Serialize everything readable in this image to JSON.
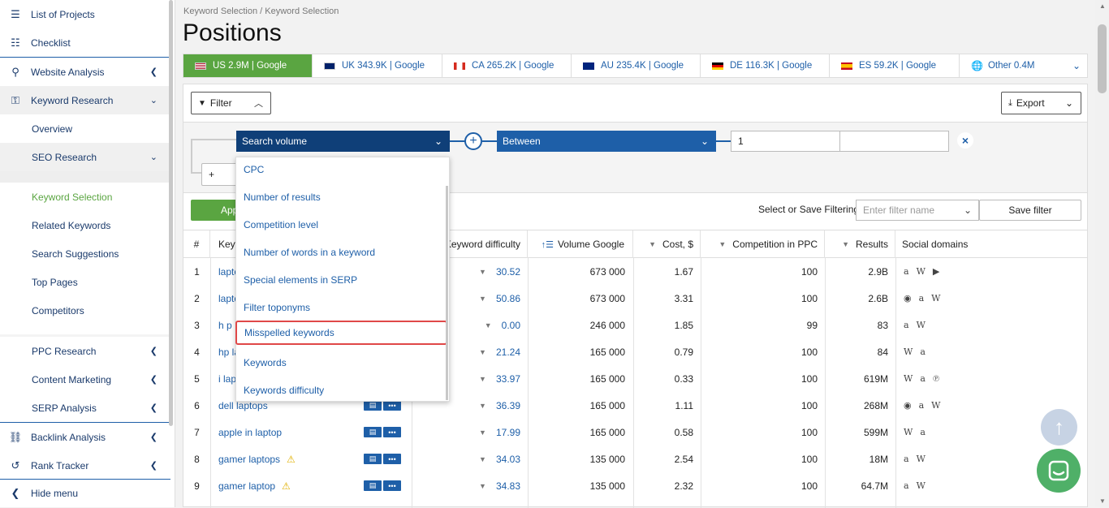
{
  "sidebar": {
    "items": [
      {
        "label": "List of Projects",
        "icon": "list-icon"
      },
      {
        "label": "Checklist",
        "icon": "checklist-icon"
      },
      {
        "label": "Website Analysis",
        "icon": "analysis-icon"
      },
      {
        "label": "Keyword Research",
        "icon": "key-icon"
      },
      {
        "label": "Overview"
      },
      {
        "label": "SEO Research"
      },
      {
        "label": "Keyword Selection"
      },
      {
        "label": "Related Keywords"
      },
      {
        "label": "Search Suggestions"
      },
      {
        "label": "Top Pages"
      },
      {
        "label": "Competitors"
      },
      {
        "label": "PPC Research"
      },
      {
        "label": "Content Marketing"
      },
      {
        "label": "SERP Analysis"
      },
      {
        "label": "Backlink Analysis",
        "icon": "link-icon"
      },
      {
        "label": "Rank Tracker",
        "icon": "history-icon"
      },
      {
        "label": "Hide menu",
        "icon": "chevron-left-icon"
      }
    ]
  },
  "breadcrumb": "Keyword Selection / Keyword Selection",
  "page_title": "Positions",
  "regions": [
    {
      "label": "US 2.9M | Google"
    },
    {
      "label": "UK 343.9K | Google"
    },
    {
      "label": "CA 265.2K | Google"
    },
    {
      "label": "AU 235.4K | Google"
    },
    {
      "label": "DE 116.3K | Google"
    },
    {
      "label": "ES 59.2K | Google"
    },
    {
      "label": "Other 0.4M"
    }
  ],
  "toolbar": {
    "filter_label": "Filter",
    "export_label": "Export"
  },
  "filter": {
    "field_label": "Search volume",
    "condition_label": "Between",
    "value_from": "1",
    "value_to": "",
    "apply_label": "Appl",
    "select_save_label": "Select or Save Filtering:",
    "filter_name_placeholder": "Enter filter name",
    "save_label": "Save filter"
  },
  "dropdown": {
    "options": [
      "CPC",
      "Number of results",
      "Competition level",
      "Number of words in a keyword",
      "Special elements in SERP",
      "Filter toponyms",
      "Misspelled keywords",
      "Keywords",
      "Keywords difficulty"
    ],
    "highlighted": "Misspelled keywords"
  },
  "table": {
    "headers": {
      "num": "#",
      "keyword": "Keyw",
      "difficulty": "Keyword difficulty",
      "volume": "Volume Google",
      "cost": "Cost, $",
      "competition": "Competition in PPC",
      "results": "Results",
      "social": "Social domains"
    },
    "rows": [
      {
        "n": "1",
        "kw": "lapto",
        "diff": "30.52",
        "vol": "673 000",
        "cost": "1.67",
        "comp": "100",
        "res": "2.9B",
        "social": [
          "amazon-icon",
          "wikipedia-icon",
          "youtube-icon"
        ]
      },
      {
        "n": "2",
        "kw": "lapto",
        "diff": "50.86",
        "vol": "673 000",
        "cost": "3.31",
        "comp": "100",
        "res": "2.6B",
        "social": [
          "reddit-icon",
          "amazon-icon",
          "wikipedia-icon"
        ]
      },
      {
        "n": "3",
        "kw": "h p",
        "diff": "0.00",
        "vol": "246 000",
        "cost": "1.85",
        "comp": "99",
        "res": "83",
        "social": [
          "amazon-icon",
          "wikipedia-icon"
        ]
      },
      {
        "n": "4",
        "kw": "hp la",
        "diff": "21.24",
        "vol": "165 000",
        "cost": "0.79",
        "comp": "100",
        "res": "84",
        "social": [
          "wikipedia-icon",
          "amazon-icon"
        ]
      },
      {
        "n": "5",
        "kw": "i lap",
        "diff": "33.97",
        "vol": "165 000",
        "cost": "0.33",
        "comp": "100",
        "res": "619M",
        "social": [
          "wikipedia-icon",
          "amazon-icon",
          "pinterest-icon"
        ]
      },
      {
        "n": "6",
        "kw": "dell laptops",
        "diff": "36.39",
        "vol": "165 000",
        "cost": "1.11",
        "comp": "100",
        "res": "268M",
        "social": [
          "reddit-icon",
          "amazon-icon",
          "wikipedia-icon"
        ]
      },
      {
        "n": "7",
        "kw": "apple in laptop",
        "diff": "17.99",
        "vol": "165 000",
        "cost": "0.58",
        "comp": "100",
        "res": "599M",
        "social": [
          "wikipedia-icon",
          "amazon-icon"
        ]
      },
      {
        "n": "8",
        "kw": "gamer laptops",
        "diff": "34.03",
        "vol": "135 000",
        "cost": "2.54",
        "comp": "100",
        "res": "18M",
        "social": [
          "amazon-icon",
          "wikipedia-icon"
        ],
        "warn": true
      },
      {
        "n": "9",
        "kw": "gamer laptop",
        "diff": "34.83",
        "vol": "135 000",
        "cost": "2.32",
        "comp": "100",
        "res": "64.7M",
        "social": [
          "amazon-icon",
          "wikipedia-icon"
        ],
        "warn": true
      }
    ]
  },
  "colors": {
    "accent": "#1e5fa8",
    "green": "#5aa541",
    "highlight": "#e04848"
  }
}
